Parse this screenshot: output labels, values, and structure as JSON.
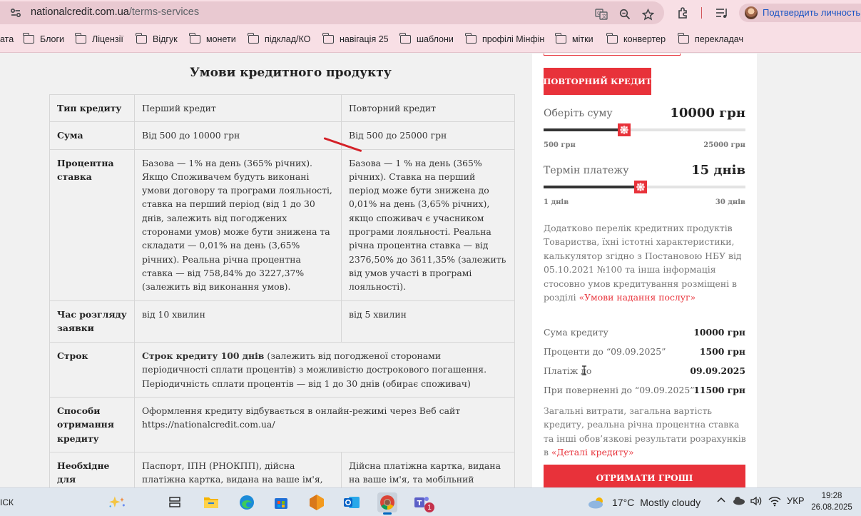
{
  "browser": {
    "url_host": "nationalcredit.com.ua",
    "url_path": "/terms-services",
    "profile_label": "Подтвердить личность",
    "icons": [
      "site-settings-icon",
      "translate-icon",
      "zoom-icon",
      "bookmark-star-icon",
      "extensions-icon",
      "reading-list-icon",
      "avatar"
    ]
  },
  "bookmarks": [
    {
      "label": "ата",
      "folder": false
    },
    {
      "label": "Блоги",
      "folder": true
    },
    {
      "label": "Ліцензії",
      "folder": true
    },
    {
      "label": "Відгук",
      "folder": true
    },
    {
      "label": "монети",
      "folder": true
    },
    {
      "label": "підклад/КО",
      "folder": true
    },
    {
      "label": "навігація 25",
      "folder": true
    },
    {
      "label": "шаблони",
      "folder": true
    },
    {
      "label": "профілі Мінфін",
      "folder": true
    },
    {
      "label": "мітки",
      "folder": true
    },
    {
      "label": "конвертер",
      "folder": true
    },
    {
      "label": "перекладач",
      "folder": true
    }
  ],
  "page": {
    "title": "Умови кредитного продукту",
    "table": {
      "header": {
        "label": "Тип кредиту",
        "first": "Перший кредит",
        "repeat": "Повторний кредит"
      },
      "sum": {
        "label": "Сума",
        "first": "Від 500 до 10000 грн",
        "repeat": "Від 500 до 25000 грн"
      },
      "rate": {
        "label": "Процентна ставка",
        "first": "Базова — 1% на день (365% річних). Якщо Споживачем будуть виконані умови договору та програми лояльності, ставка на перший період (від 1 до 30 днів, залежить від погоджених сторонами умов) може бути знижена та складати — 0,01% на день (3,65% річних). Реальна річна процентна ставка — від 758,84% до 3227,37% (залежить від виконання умов).",
        "repeat": "Базова — 1 % на день (365% річних). Ставка на перший період може бути знижена до 0,01% на день (3,65% річних), якщо споживач є учасником програми лояльності. Реальна річна процентна ставка — від 2376,50% до 3611,35% (залежить від умов участі в програмі лояльності)."
      },
      "review": {
        "label": "Час розгляду заявки",
        "first": "від 10 хвилин",
        "repeat": "від 5 хвилин"
      },
      "term": {
        "label": "Строк",
        "bold": "Строк кредиту 100 днів",
        "rest": " (залежить від погодженої сторонами періодичності сплати процентів) з можливістю дострокового погашення. Періодичність сплати процентів — від 1 до 30 днів (обирає споживач)"
      },
      "methods": {
        "label": "Способи отримання кредиту",
        "text": "Оформлення кредиту відбувається в онлайн-режимі через Веб сайт https://nationalcredit.com.ua/"
      },
      "docs": {
        "label": "Необхідне для оформлення онлайн-",
        "first": "Паспорт, ІПН (РНОКПП), дійсна платіжна картка, видана на ваше ім'я, мобільний телефон",
        "repeat": "Дійсна платіжна картка, видана на ваше ім'я, та мобільний телефон. Під час оформлення повторного"
      }
    }
  },
  "calculator": {
    "repeat_button": "ПОВТОРНИЙ КРЕДИТ",
    "amount": {
      "label": "Оберіть суму",
      "value": "10000 грн",
      "min": "500 грн",
      "max": "25000 грн",
      "level": 0.4
    },
    "term": {
      "label": "Термін платежу",
      "value": "15 днів",
      "min": "1 днів",
      "max": "30 днів",
      "level": 0.48
    },
    "info_text": "Додатково перелік кредитних продуктів Товариства, їхні істотні характеристики, калькулятор згідно з Постановою НБУ від 05.10.2021 №100 та інша інформація стосовно умов кредитування розміщені в розділі ",
    "info_link": "«Умови надання послуг»",
    "summary": [
      {
        "label": "Сума кредиту",
        "value": "10000 грн"
      },
      {
        "label": "Проценти до “09.09.2025”",
        "value": "1500 грн"
      },
      {
        "label": "Платіж до",
        "value": "09.09.2025"
      },
      {
        "label": "При поверненні до “09.09.2025”",
        "value": "11500 грн"
      }
    ],
    "costs_text": "Загальні витрати, загальна вартість кредиту, реальна річна процентна ставка та інші обов’язкові результати розрахунків в ",
    "costs_link": "«Деталі кредиту»",
    "get_money_button": "ОТРИМАТИ ГРОШІ",
    "accent_color": "#e8323a"
  },
  "taskbar": {
    "search_text": "ІСК",
    "apps": [
      "copilot-icon",
      "task-view-icon",
      "file-explorer-icon",
      "edge-icon",
      "store-icon",
      "app-orange-icon",
      "outlook-icon",
      "chrome-icon",
      "teams-icon"
    ],
    "teams_badge": "1",
    "weather_temp": "17°C",
    "weather_text": "Mostly cloudy",
    "language": "УКР",
    "time": "19:28",
    "date": "26.08.2025"
  }
}
